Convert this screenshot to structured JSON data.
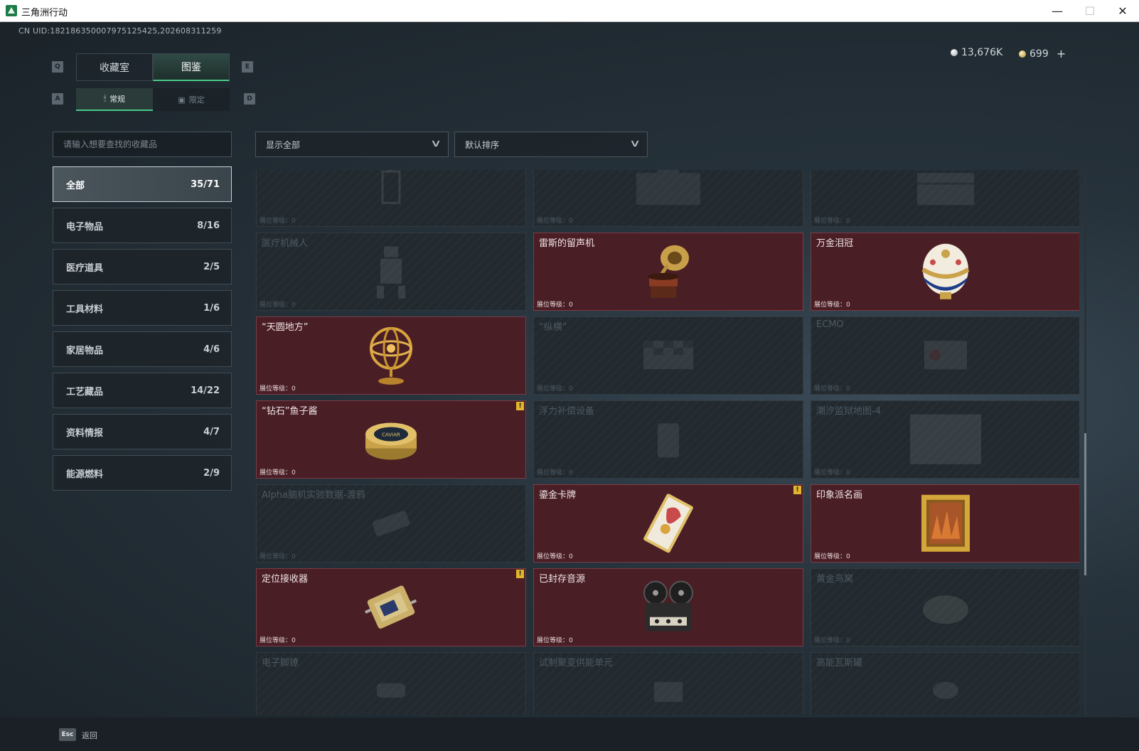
{
  "window": {
    "title": "三角洲行动",
    "min": "—",
    "max": "☐",
    "close": "✕"
  },
  "uid": "CN UID:18218635000797512542​5,202608311259",
  "currency": {
    "silver": "13,676K",
    "gold": "699",
    "add": "+"
  },
  "keys": {
    "q": "Q",
    "e": "E",
    "a": "A",
    "d": "D"
  },
  "main_tabs": [
    {
      "label": "收藏室"
    },
    {
      "label": "图鉴"
    }
  ],
  "sub_tabs": [
    {
      "label": "常规"
    },
    {
      "label": "限定"
    }
  ],
  "search": {
    "placeholder": "请输入想要查找的收藏品"
  },
  "categories": [
    {
      "label": "全部",
      "count": "35/71"
    },
    {
      "label": "电子物品",
      "count": "8/16"
    },
    {
      "label": "医疗道具",
      "count": "2/5"
    },
    {
      "label": "工具材料",
      "count": "1/6"
    },
    {
      "label": "家居物品",
      "count": "4/6"
    },
    {
      "label": "工艺藏品",
      "count": "14/22"
    },
    {
      "label": "资料情报",
      "count": "4/7"
    },
    {
      "label": "能源燃料",
      "count": "2/9"
    }
  ],
  "filters": {
    "display": "显示全部",
    "sort": "默认排序"
  },
  "level_label": "展位等级：0",
  "items": [
    {
      "name": "",
      "owned": false,
      "icon": "lantern-icon"
    },
    {
      "name": "",
      "owned": false,
      "icon": "case-icon"
    },
    {
      "name": "",
      "owned": false,
      "icon": "chest-icon"
    },
    {
      "name": "医疗机械人",
      "owned": false,
      "icon": "robot-icon"
    },
    {
      "name": "雷斯的留声机",
      "owned": true,
      "icon": "gramophone-icon"
    },
    {
      "name": "万金泪冠",
      "owned": true,
      "icon": "jeweled-egg-icon"
    },
    {
      "name": "“天圆地方”",
      "owned": true,
      "icon": "armillary-sphere-icon"
    },
    {
      "name": "“纵横”",
      "owned": false,
      "icon": "chessboard-icon"
    },
    {
      "name": "ECMO",
      "owned": false,
      "icon": "ecmo-machine-icon"
    },
    {
      "name": "“钻石”鱼子酱",
      "owned": true,
      "icon": "caviar-tin-icon",
      "badge": "!"
    },
    {
      "name": "浮力补偿设备",
      "owned": false,
      "icon": "bcd-vest-icon"
    },
    {
      "name": "潮汐监狱地图-4",
      "owned": false,
      "icon": "map-icon"
    },
    {
      "name": "Alpha脑机实验数据-渡鸦",
      "owned": false,
      "icon": "drive-icon"
    },
    {
      "name": "鎏金卡牌",
      "owned": true,
      "icon": "gilded-card-icon",
      "badge": "!"
    },
    {
      "name": "印象派名画",
      "owned": true,
      "icon": "framed-painting-icon"
    },
    {
      "name": "定位接收器",
      "owned": true,
      "icon": "gps-receiver-icon",
      "badge": "!"
    },
    {
      "name": "已封存音源",
      "owned": true,
      "icon": "reel-to-reel-icon"
    },
    {
      "name": "黄金鸟窝",
      "owned": false,
      "icon": "bird-nest-icon"
    },
    {
      "name": "电子脚镣",
      "owned": false,
      "icon": "ankle-monitor-icon"
    },
    {
      "name": "试制聚变供能单元",
      "owned": false,
      "icon": "fusion-cell-icon"
    },
    {
      "name": "高能瓦斯罐",
      "owned": false,
      "icon": "gas-canister-icon"
    }
  ],
  "footer": {
    "esc": "Esc",
    "back": "返回"
  }
}
